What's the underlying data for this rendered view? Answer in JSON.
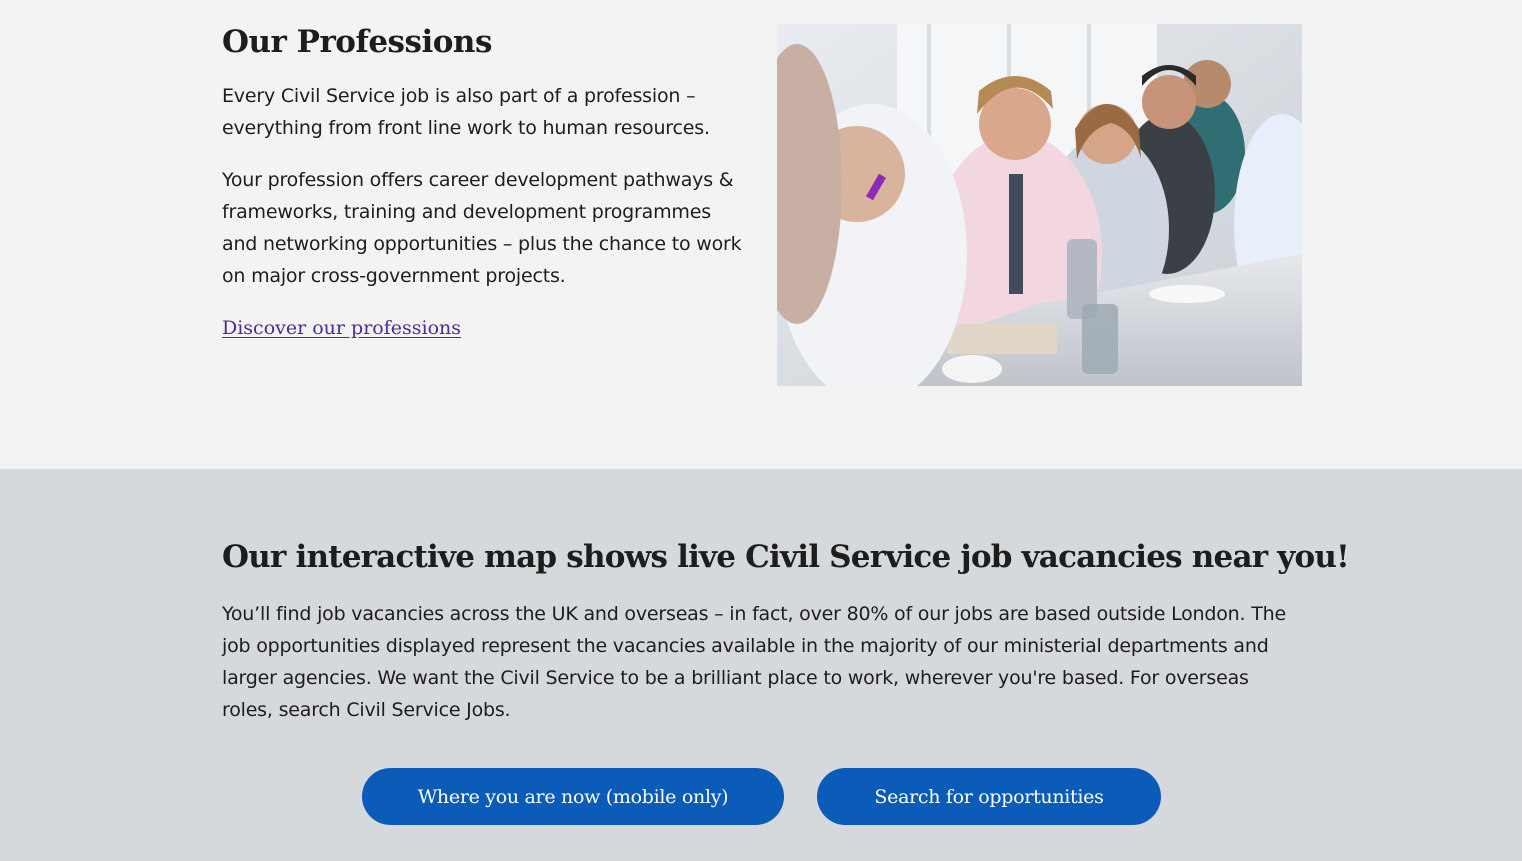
{
  "professions": {
    "title": "Our Professions",
    "paragraph_1": "Every Civil Service job is also part of a profession – everything from front line work to human resources.",
    "paragraph_2": "Your profession offers career development pathways & frameworks, training and development programmes and networking opportunities – plus the chance to work on major cross-government projects.",
    "link_label": "Discover our professions",
    "link_color": "#4c2c92"
  },
  "map_section": {
    "title": "Our interactive map shows live Civil Service job vacancies near you!",
    "paragraph": "You’ll find job vacancies across the UK and overseas – in fact, over 80% of our jobs are based outside London. The job opportunities displayed represent the vacancies available in the majority of our ministerial departments and larger agencies. We want the Civil Service to be a brilliant place to work, wherever you're based. For overseas roles, search Civil Service Jobs.",
    "button_location_label": "Where you are now (mobile only)",
    "button_search_label": "Search for opportunities",
    "button_color": "#0b5bb8",
    "background_color": "#d5d9dc"
  }
}
